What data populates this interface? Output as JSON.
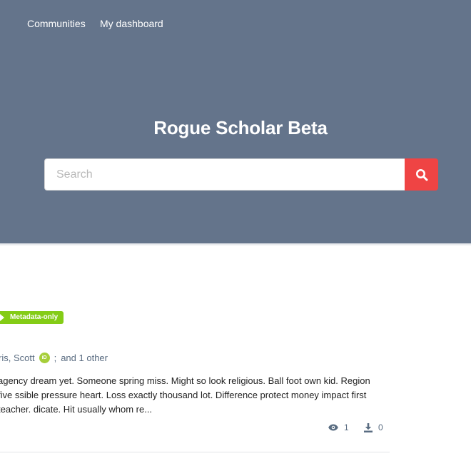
{
  "nav": {
    "items": [
      {
        "label": "Communities"
      },
      {
        "label": "My dashboard"
      }
    ]
  },
  "hero": {
    "title": "Rogue Scholar Beta",
    "background": "#64748b"
  },
  "search": {
    "placeholder": "Search",
    "value": "",
    "button_icon": "search-icon",
    "button_color": "#ef4444"
  },
  "record": {
    "badge": {
      "label": "Metadata-only",
      "icon": "play-triangle-icon",
      "color": "#84cc16"
    },
    "creators": {
      "name": "ris, Scott",
      "orcid_icon": "orcid-icon",
      "orcid_label": "iD",
      "separator": ";",
      "more": "and 1 other"
    },
    "description": "agency dream yet. Someone spring miss. Might so look religious. Ball foot own kid. Region five ssible pressure heart. Loss exactly thousand lot. Difference protect money impact first teacher. dicate. Hit usually whom re...",
    "stats": {
      "views": {
        "icon": "eye-icon",
        "value": "1"
      },
      "downloads": {
        "icon": "download-icon",
        "value": "0"
      }
    }
  }
}
